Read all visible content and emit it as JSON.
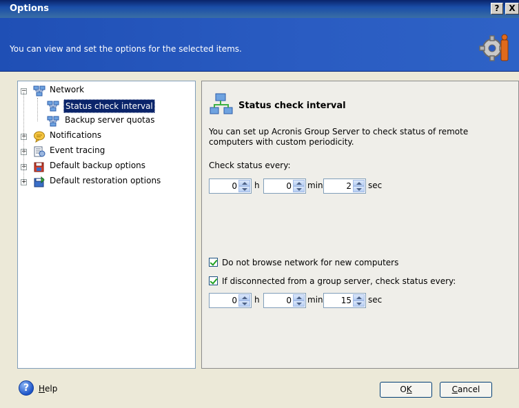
{
  "window": {
    "title": "Options",
    "help_btn": "?",
    "close_btn": "X"
  },
  "header": {
    "description": "You can view and set the options for the selected items.",
    "icon": "gear-icon"
  },
  "tree": {
    "items": [
      {
        "label": "Network",
        "icon": "network-icon",
        "expander": "−"
      },
      {
        "label": "Status check interval",
        "icon": "network-icon",
        "selected": true
      },
      {
        "label": "Backup server quotas",
        "icon": "network-icon"
      },
      {
        "label": "Notifications",
        "icon": "notification-icon",
        "expander": "+"
      },
      {
        "label": "Event tracing",
        "icon": "event-tracing-icon",
        "expander": "+"
      },
      {
        "label": "Default backup options",
        "icon": "backup-icon",
        "expander": "+"
      },
      {
        "label": "Default restoration options",
        "icon": "restore-icon",
        "expander": "+"
      }
    ]
  },
  "panel": {
    "title": "Status check interval",
    "icon": "network-icon",
    "description": "You can set up Acronis Group Server to check status of remote computers with custom periodicity.",
    "check_label": "Check status every:",
    "interval1": {
      "hours": "0",
      "minutes": "0",
      "seconds": "2"
    },
    "units": {
      "h": "h",
      "min": "min",
      "sec": "sec"
    },
    "checkbox1": {
      "label": "Do not browse network for new computers",
      "checked": true
    },
    "checkbox2": {
      "label": "If disconnected from a group server, check status every:",
      "checked": true
    },
    "interval2": {
      "hours": "0",
      "minutes": "0",
      "seconds": "15"
    }
  },
  "footer": {
    "help_label": "Help",
    "help_accesskey": "H",
    "help_rest": "elp",
    "ok_label": "OK",
    "ok_accesskey": "K",
    "ok_pre": "O",
    "cancel_label": "Cancel",
    "cancel_accesskey": "C",
    "cancel_rest": "ancel"
  },
  "colors": {
    "title_bar": "#0A246A",
    "header": "#2A5CC2",
    "selection": "#0A246A",
    "dialog_bg": "#ECE9D8"
  }
}
